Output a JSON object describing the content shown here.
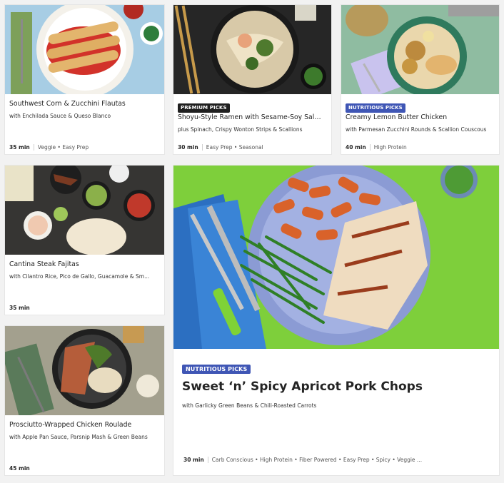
{
  "recipes": [
    {
      "title": "Southwest Corn & Zucchini Flautas",
      "subtitle": "with Enchilada Sauce & Queso Blanco",
      "time": "35 min",
      "tags": "Veggie • Easy Prep",
      "badge": ""
    },
    {
      "title": "Shoyu-Style Ramen with Sesame-Soy Salm...",
      "subtitle": "plus Spinach, Crispy Wonton Strips & Scallions",
      "time": "30 min",
      "tags": "Easy Prep • Seasonal",
      "badge": "PREMIUM PICKS"
    },
    {
      "title": "Creamy Lemon Butter Chicken",
      "subtitle": "with Parmesan Zucchini Rounds & Scallion Couscous",
      "time": "40 min",
      "tags": "High Protein",
      "badge": "NUTRITIOUS PICKS"
    },
    {
      "title": "Cantina Steak Fajitas",
      "subtitle": "with Cilantro Rice, Pico de Gallo, Guacamole & Sm...",
      "time": "35 min",
      "tags": "",
      "badge": ""
    },
    {
      "title": "Prosciutto-Wrapped Chicken Roulade",
      "subtitle": "with Apple Pan Sauce, Parsnip Mash & Green Beans",
      "time": "45 min",
      "tags": "",
      "badge": ""
    }
  ],
  "featured": {
    "badge": "NUTRITIOUS PICKS",
    "title": "Sweet ‘n’ Spicy Apricot Pork Chops",
    "subtitle": "with Garlicky Green Beans & Chili-Roasted Carrots",
    "time": "30 min",
    "tags": "Carb Conscious • High Protein • Fiber Powered • Easy Prep • Spicy • Veggie ..."
  },
  "colors": {
    "premium_badge": "#1f1f1f",
    "nutritious_badge": "#3f56b5",
    "featured_background": "#7ed03a"
  }
}
